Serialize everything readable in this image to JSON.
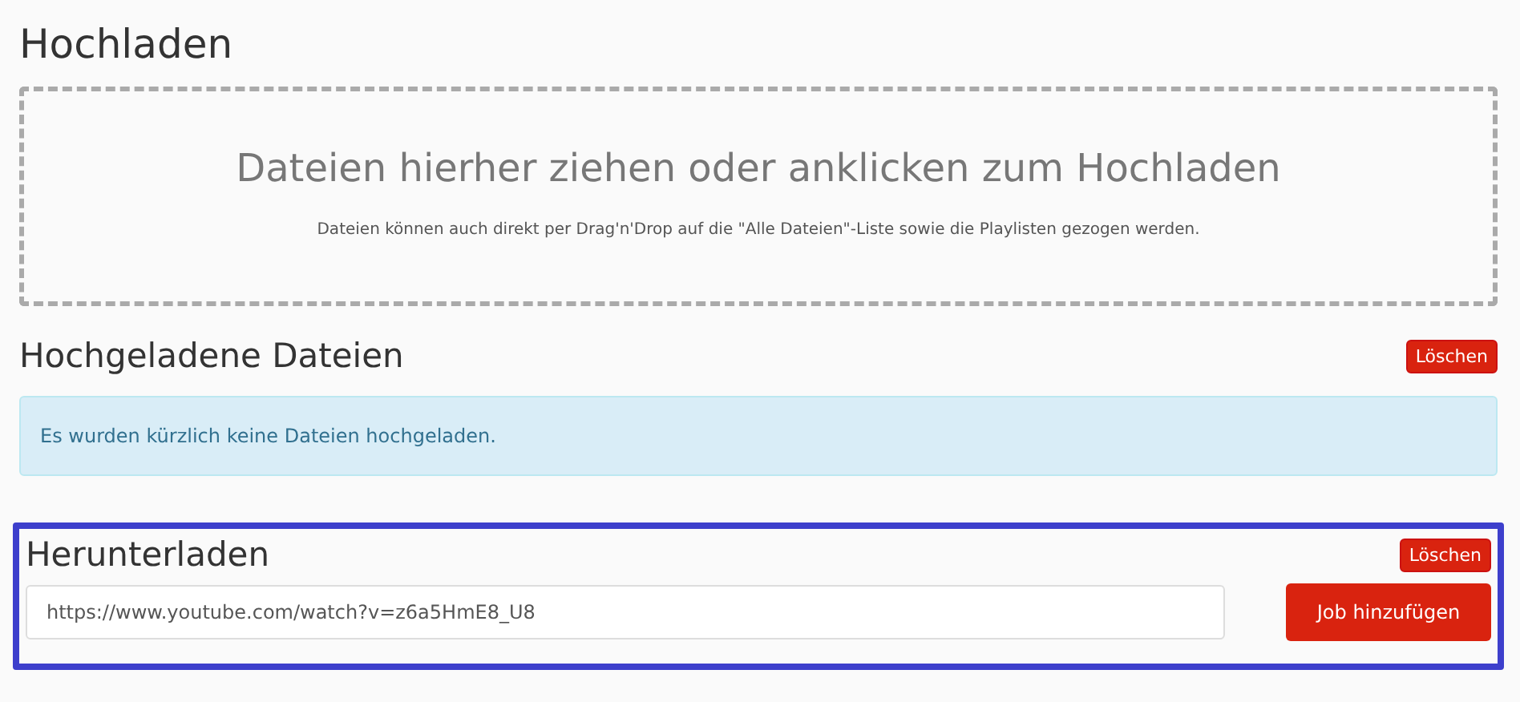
{
  "upload": {
    "title": "Hochladen",
    "dropzone": {
      "headline": "Dateien hierher ziehen oder anklicken zum Hochladen",
      "hint": "Dateien können auch direkt per Drag'n'Drop auf die \"Alle Dateien\"-Liste sowie die Playlisten gezogen werden."
    }
  },
  "uploaded": {
    "title": "Hochgeladene Dateien",
    "clear_button": "Löschen",
    "message": "Es wurden kürzlich keine Dateien hochgeladen."
  },
  "download": {
    "title": "Herunterladen",
    "highlighted": true,
    "clear_button": "Löschen",
    "url_field": {
      "value": "https://www.youtube.com/watch?v=z6a5HmE8_U8"
    },
    "add_button": "Job hinzufügen"
  }
}
